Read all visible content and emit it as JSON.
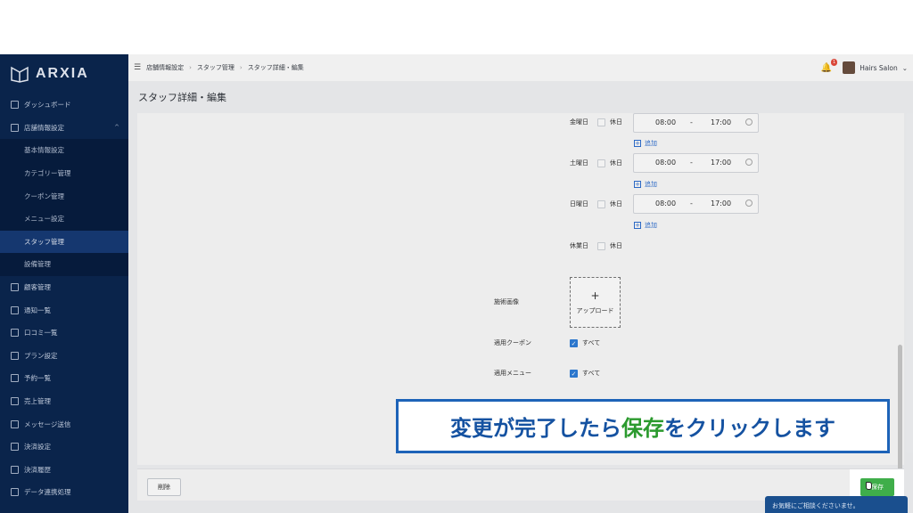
{
  "app": {
    "brand": "ARXIA"
  },
  "sidebar": {
    "items": [
      {
        "label": "ダッシュボード",
        "icon": "dashboard-icon"
      },
      {
        "label": "店舗情報設定",
        "icon": "store-icon",
        "expanded": true
      },
      {
        "label": "基本情報設定",
        "sub": true
      },
      {
        "label": "カテゴリー管理",
        "sub": true
      },
      {
        "label": "クーポン管理",
        "sub": true
      },
      {
        "label": "メニュー設定",
        "sub": true
      },
      {
        "label": "スタッフ管理",
        "sub": true,
        "active": true
      },
      {
        "label": "設備管理",
        "sub": true
      },
      {
        "label": "顧客管理",
        "icon": "customers-icon"
      },
      {
        "label": "通知一覧",
        "icon": "notification-icon"
      },
      {
        "label": "口コミ一覧",
        "icon": "review-icon"
      },
      {
        "label": "プラン設定",
        "icon": "plan-icon"
      },
      {
        "label": "予約一覧",
        "icon": "calendar-icon"
      },
      {
        "label": "売上管理",
        "icon": "sales-icon"
      },
      {
        "label": "メッセージ送信",
        "icon": "message-icon"
      },
      {
        "label": "決済設定",
        "icon": "payment-icon"
      },
      {
        "label": "決済履歴",
        "icon": "history-icon"
      },
      {
        "label": "データ連携処理",
        "icon": "data-icon"
      }
    ]
  },
  "header": {
    "breadcrumb": [
      "店舗情報設定",
      "スタッフ管理",
      "スタッフ詳細・編集"
    ],
    "notification_count": "1",
    "user": "Hairs Salon"
  },
  "page": {
    "title": "スタッフ詳細・編集"
  },
  "schedule": {
    "holiday_label": "休日",
    "add_label": "追加",
    "days": [
      {
        "day": "金曜日",
        "start": "08:00",
        "dash": "-",
        "end": "17:00"
      },
      {
        "day": "土曜日",
        "start": "08:00",
        "dash": "-",
        "end": "17:00"
      },
      {
        "day": "日曜日",
        "start": "08:00",
        "dash": "-",
        "end": "17:00"
      }
    ],
    "public_holiday": "休業日"
  },
  "form": {
    "image_label": "施術画像",
    "upload_label": "アップロード",
    "upload_plus": "+",
    "coupon_label": "適用クーポン",
    "coupon_all": "すべて",
    "menu_label": "適用メニュー",
    "menu_all": "すべて"
  },
  "footer": {
    "delete_label": "削除",
    "save_label": "保存"
  },
  "chat": {
    "text": "お気軽にご相談くださいませ。"
  },
  "caption": {
    "pre": "変更が完了したら",
    "highlight": "保存",
    "post": "をクリックします"
  },
  "colors": {
    "sidebar": "#0b2650",
    "accent": "#1d63b8",
    "save": "#3fae4a",
    "highlight": "#2b9a2e"
  }
}
